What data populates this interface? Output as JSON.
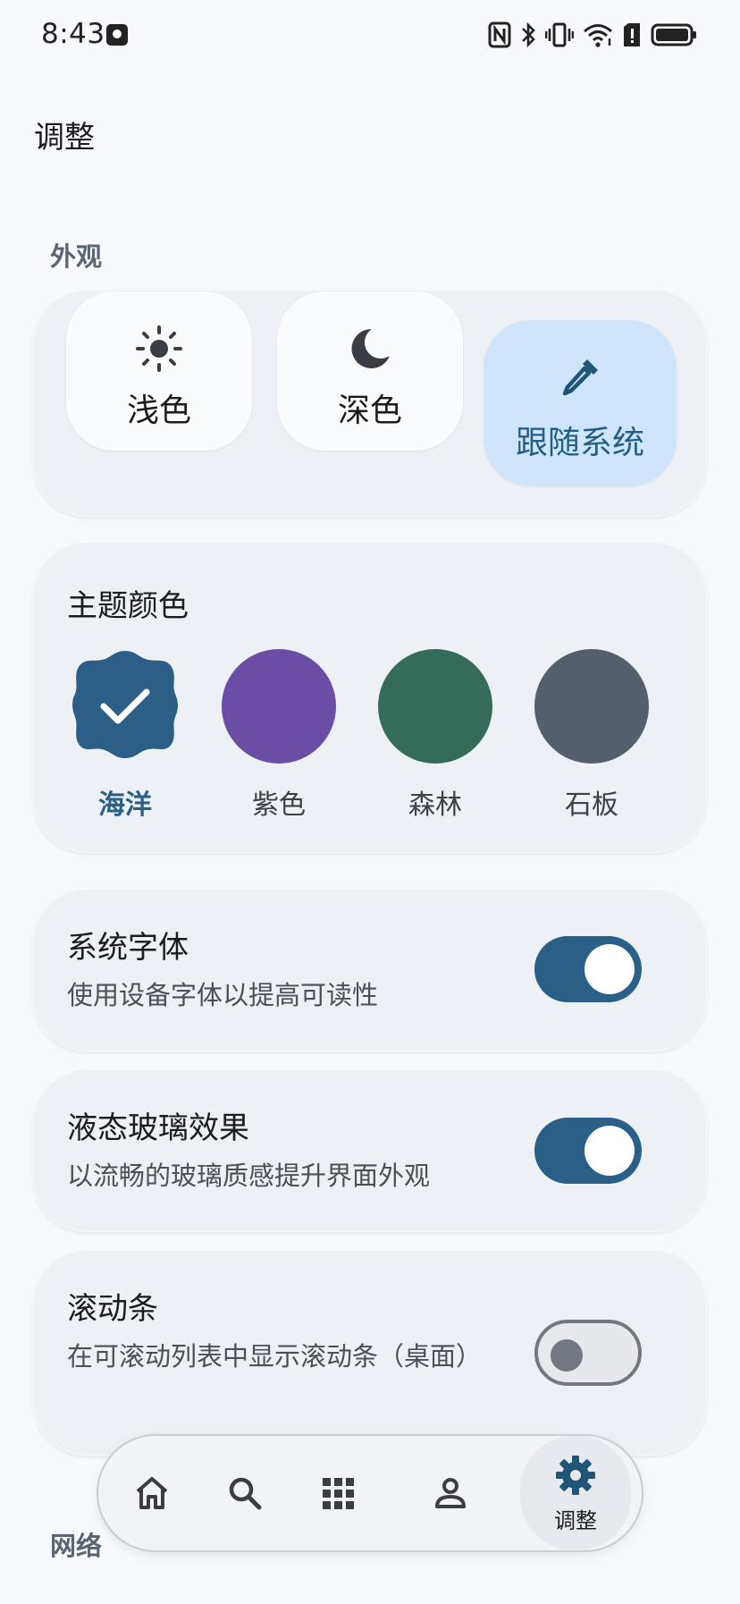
{
  "status_bar": {
    "time": "8:43"
  },
  "page": {
    "title": "调整"
  },
  "appearance": {
    "section_label": "外观",
    "modes": [
      {
        "label": "浅色",
        "icon": "sun-icon",
        "selected": false
      },
      {
        "label": "深色",
        "icon": "moon-icon",
        "selected": false
      },
      {
        "label": "跟随系统",
        "icon": "eyedropper-icon",
        "selected": true
      }
    ]
  },
  "theme_color": {
    "title": "主题颜色",
    "swatches": [
      {
        "label": "海洋",
        "color": "#2b5f88",
        "selected": true
      },
      {
        "label": "紫色",
        "color": "#6a4ea6",
        "selected": false
      },
      {
        "label": "森林",
        "color": "#356b59",
        "selected": false
      },
      {
        "label": "石板",
        "color": "#555f6c",
        "selected": false
      }
    ]
  },
  "settings": [
    {
      "title": "系统字体",
      "description": "使用设备字体以提高可读性",
      "enabled": true
    },
    {
      "title": "液态玻璃效果",
      "description": "以流畅的玻璃质感提升界面外观",
      "enabled": true
    },
    {
      "title": "滚动条",
      "description": "在可滚动列表中显示滚动条（桌面）",
      "enabled": false
    }
  ],
  "network": {
    "section_label": "网络"
  },
  "bottom_nav": {
    "items": [
      {
        "icon": "home-icon"
      },
      {
        "icon": "search-icon"
      },
      {
        "icon": "grid-icon"
      },
      {
        "icon": "person-icon"
      },
      {
        "icon": "gear-icon",
        "label": "调整",
        "active": true
      }
    ]
  },
  "colors": {
    "accent": "#2a5f88",
    "selected_mode_bg": "#cfe5fb",
    "card_bg": "#edf0f5",
    "page_bg": "#f7f9fd"
  }
}
